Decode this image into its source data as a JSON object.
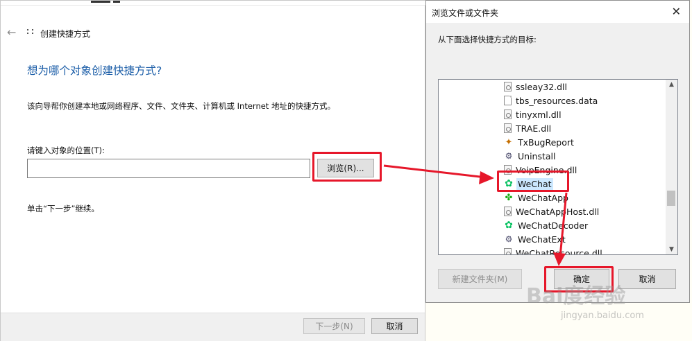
{
  "wizard": {
    "title": "创建快捷方式",
    "heading": "想为哪个对象创建快捷方式?",
    "description": "该向导帮你创建本地或网络程序、文件、文件夹、计算机或 Internet 地址的快捷方式。",
    "location_label": "请键入对象的位置(T):",
    "location_value": "",
    "browse_label": "浏览(R)...",
    "next_hint": "单击“下一步”继续。",
    "next_label": "下一步(N)",
    "cancel_label": "取消"
  },
  "dialog": {
    "title": "浏览文件或文件夹",
    "close_glyph": "✕",
    "prompt": "从下面选择快捷方式的目标:",
    "items": [
      {
        "label": "ssleay32.dll",
        "icon": "dll-file-icon"
      },
      {
        "label": "tbs_resources.data",
        "icon": "file-icon"
      },
      {
        "label": "tinyxml.dll",
        "icon": "dll-file-icon"
      },
      {
        "label": "TRAE.dll",
        "icon": "dll-file-icon"
      },
      {
        "label": "TxBugReport",
        "icon": "bug-report-icon"
      },
      {
        "label": "Uninstall",
        "icon": "installer-icon"
      },
      {
        "label": "VoipEngine.dll",
        "icon": "dll-file-icon"
      },
      {
        "label": "WeChat",
        "icon": "wechat-icon",
        "selected": true
      },
      {
        "label": "WeChatApp",
        "icon": "wechat-app-icon"
      },
      {
        "label": "WeChatAppHost.dll",
        "icon": "dll-file-icon"
      },
      {
        "label": "WeChatDecoder",
        "icon": "wechat-icon"
      },
      {
        "label": "WeChatExt",
        "icon": "installer-icon"
      },
      {
        "label": "WeChatResource.dll",
        "icon": "dll-file-icon"
      }
    ],
    "new_folder_label": "新建文件夹(M)",
    "ok_label": "确定",
    "cancel_label": "取消"
  },
  "annotation_color": "#e6172a",
  "watermark": {
    "text": "Bai度经验",
    "sub": "jingyan.baidu.com"
  }
}
